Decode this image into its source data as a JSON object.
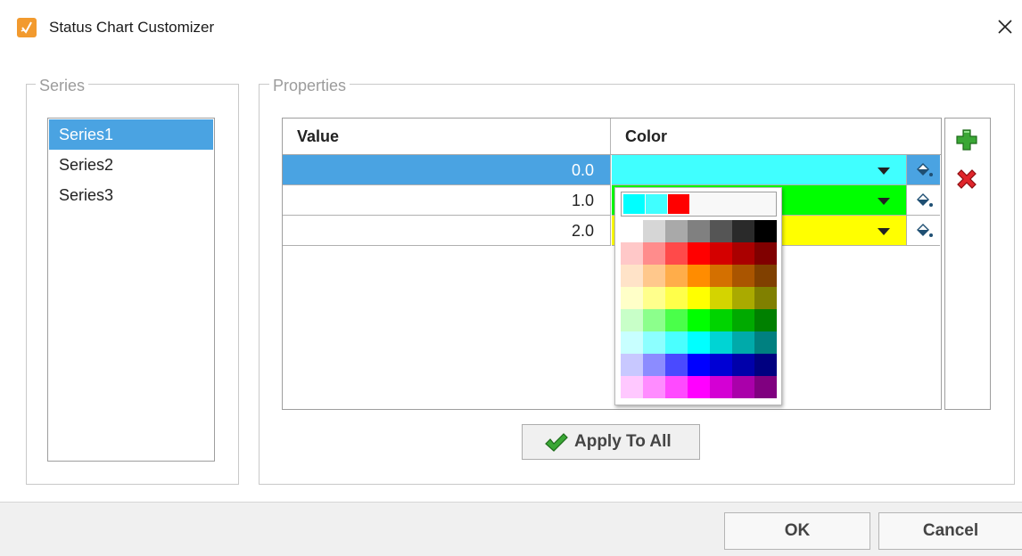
{
  "window": {
    "title": "Status Chart Customizer",
    "icon": "brush-icon",
    "close_icon": "close-icon"
  },
  "series_panel": {
    "legend": "Series",
    "items": [
      "Series1",
      "Series2",
      "Series3"
    ],
    "selected": "Series1"
  },
  "properties_panel": {
    "legend": "Properties",
    "columns": [
      "Value",
      "Color"
    ],
    "rows": [
      {
        "value": "0.0",
        "color": "#40ffff",
        "selected": true
      },
      {
        "value": "1.0",
        "color": "#00ff00",
        "selected": false
      },
      {
        "value": "2.0",
        "color": "#ffff00",
        "selected": false
      }
    ],
    "add_icon": "plus-icon",
    "remove_icon": "x-icon",
    "cell_action_icon": "paint-bucket-icon",
    "apply_label": "Apply To All",
    "apply_icon": "checkmark-icon"
  },
  "color_palette": {
    "recent": [
      "#00ffff",
      "#40ffff",
      "#ff0000"
    ],
    "grid": [
      [
        "#ffffff",
        "#d6d6d6",
        "#a9a9a9",
        "#808080",
        "#555555",
        "#2a2a2a",
        "#000000"
      ],
      [
        "#ffc8c8",
        "#ff8c8c",
        "#ff4a4a",
        "#ff0000",
        "#d40000",
        "#aa0000",
        "#800000"
      ],
      [
        "#ffe3c8",
        "#ffc88c",
        "#ffad4a",
        "#ff8c00",
        "#d47000",
        "#aa5500",
        "#804000"
      ],
      [
        "#ffffc8",
        "#ffff8c",
        "#ffff4a",
        "#ffff00",
        "#d4d400",
        "#aaaa00",
        "#808000"
      ],
      [
        "#c8ffc8",
        "#8cff8c",
        "#4aff4a",
        "#00ff00",
        "#00d400",
        "#00aa00",
        "#008000"
      ],
      [
        "#c8ffff",
        "#8cffff",
        "#4affff",
        "#00ffff",
        "#00d4d4",
        "#00aaaa",
        "#008080"
      ],
      [
        "#c8c8ff",
        "#8c8cff",
        "#4a4aff",
        "#0000ff",
        "#0000d4",
        "#0000aa",
        "#000080"
      ],
      [
        "#ffc8ff",
        "#ff8cff",
        "#ff4aff",
        "#ff00ff",
        "#d400d4",
        "#aa00aa",
        "#800080"
      ]
    ]
  },
  "footer": {
    "ok_label": "OK",
    "cancel_label": "Cancel"
  },
  "colors": {
    "selection": "#4aa3e2",
    "accent_icon": "#f29a2e"
  }
}
